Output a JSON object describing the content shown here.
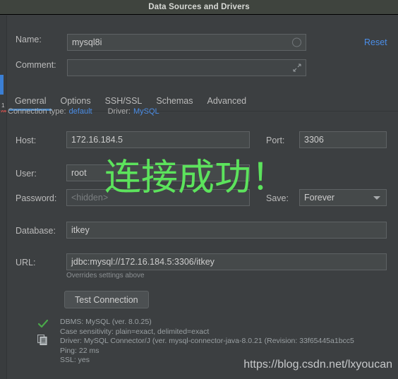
{
  "window": {
    "title": "Data Sources and Drivers"
  },
  "header": {
    "name_label": "Name:",
    "name_value": "mysql8i",
    "comment_label": "Comment:",
    "comment_value": "",
    "reset_label": "Reset"
  },
  "tabs": [
    {
      "label": "General",
      "active": true
    },
    {
      "label": "Options",
      "active": false
    },
    {
      "label": "SSH/SSL",
      "active": false
    },
    {
      "label": "Schemas",
      "active": false
    },
    {
      "label": "Advanced",
      "active": false
    }
  ],
  "connection": {
    "type_label": "Connection type:",
    "type_value": "default",
    "driver_label": "Driver:",
    "driver_value": "MySQL"
  },
  "form": {
    "host_label": "Host:",
    "host_value": "172.16.184.5",
    "port_label": "Port:",
    "port_value": "3306",
    "user_label": "User:",
    "user_value": "root",
    "password_label": "Password:",
    "password_placeholder": "<hidden>",
    "save_label": "Save:",
    "save_value": "Forever",
    "database_label": "Database:",
    "database_value": "itkey",
    "url_label": "URL:",
    "url_value": "jdbc:mysql://172.16.184.5:3306/itkey",
    "url_hint": "Overrides settings above",
    "test_connection_label": "Test Connection"
  },
  "status": {
    "lines": [
      "DBMS: MySQL (ver. 8.0.25)",
      "Case sensitivity: plain=exact, delimited=exact",
      "Driver: MySQL Connector/J (ver. mysql-connector-java-8.0.21 (Revision: 33f65445a1bcc5",
      "Ping: 22 ms",
      "SSL: yes"
    ]
  },
  "annotation": {
    "text": "连接成功！"
  },
  "watermark": {
    "text": "https://blog.csdn.net/lxyoucan"
  },
  "colors": {
    "background": "#3c3f41",
    "titlebar": "#3f443e",
    "accent_blue": "#4b8ee8",
    "tab_underline": "#4a88c7",
    "success_green": "#5ce35c",
    "field_bg": "#45494a"
  }
}
